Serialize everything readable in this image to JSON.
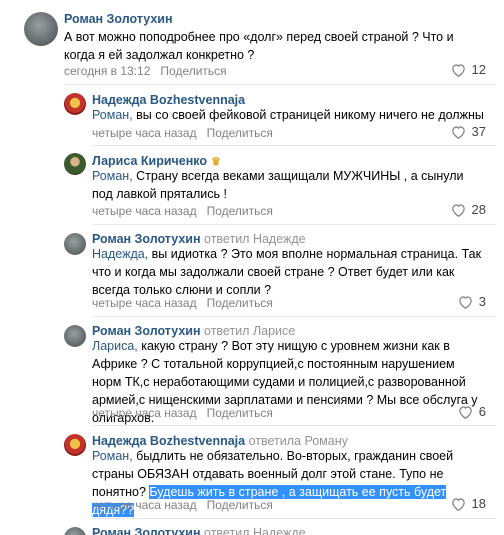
{
  "comments": [
    {
      "author": "Роман Золотухин",
      "replied": "",
      "addressee": "",
      "text": "А вот можно поподробнее про «долг» перед своей страной ? Что и когда я ей задолжал конкретно ?",
      "time": "сегодня в 13:12",
      "share": "Поделиться",
      "likes": "12"
    },
    {
      "author": "Надежда Bozhestvennaja",
      "replied": "",
      "addressee": "Роман,",
      "text": " вы со своей фейковой страницей никому ничего не должны",
      "time": "четыре часа назад",
      "share": "Поделиться",
      "likes": "37"
    },
    {
      "author": "Лариса Кириченко",
      "replied": "",
      "addressee": "Роман,",
      "text": " Страну всегда веками защищали МУЖЧИНЫ , а сынули под лавкой прятались !",
      "time": "четыре часа назад",
      "share": "Поделиться",
      "likes": "28"
    },
    {
      "author": "Роман Золотухин",
      "replied": "ответил Надежде",
      "addressee": "Надежда,",
      "text": " вы идиотка ? Это моя вполне нормальная страница. Так что и когда мы задолжали своей стране ? Ответ будет или как всегда только слюни и сопли ?",
      "time": "четыре часа назад",
      "share": "Поделиться",
      "likes": "3"
    },
    {
      "author": "Роман Золотухин",
      "replied": "ответил Ларисе",
      "addressee": "Лариса,",
      "text": " какую страну ? Вот эту нищую с уровнем жизни как в Африке ? С тотальной коррупцией,с постоянным нарушением норм ТК,с неработающими судами и полицией,с разворованной армией,с нищенскими зарплатами и пенсиями ? Мы все обслуга у олигархов.",
      "time": "четыре часа назад",
      "share": "Поделиться",
      "likes": "6"
    },
    {
      "author": "Надежда Bozhestvennaja",
      "replied": "ответила Роману",
      "addressee": "Роман,",
      "text": " быдлить не обязательно. Во-вторых, гражданин своей страны ОБЯЗАН отдавать военный долг этой стане. Тупо не понятно? ",
      "highlight": "Будешь жить в стране , а защищать ее пусть будет дядя??",
      "time": "четыре часа назад",
      "share": "Поделиться",
      "likes": "18"
    },
    {
      "author": "Роман Золотухин",
      "replied": "ответил Надежде",
      "addressee": "",
      "text": "",
      "time": "",
      "share": "",
      "likes": ""
    }
  ],
  "colors": {
    "link": "#2a5885",
    "meta": "#828282",
    "highlight": "#3390ff",
    "crown": "#e4a82b"
  }
}
